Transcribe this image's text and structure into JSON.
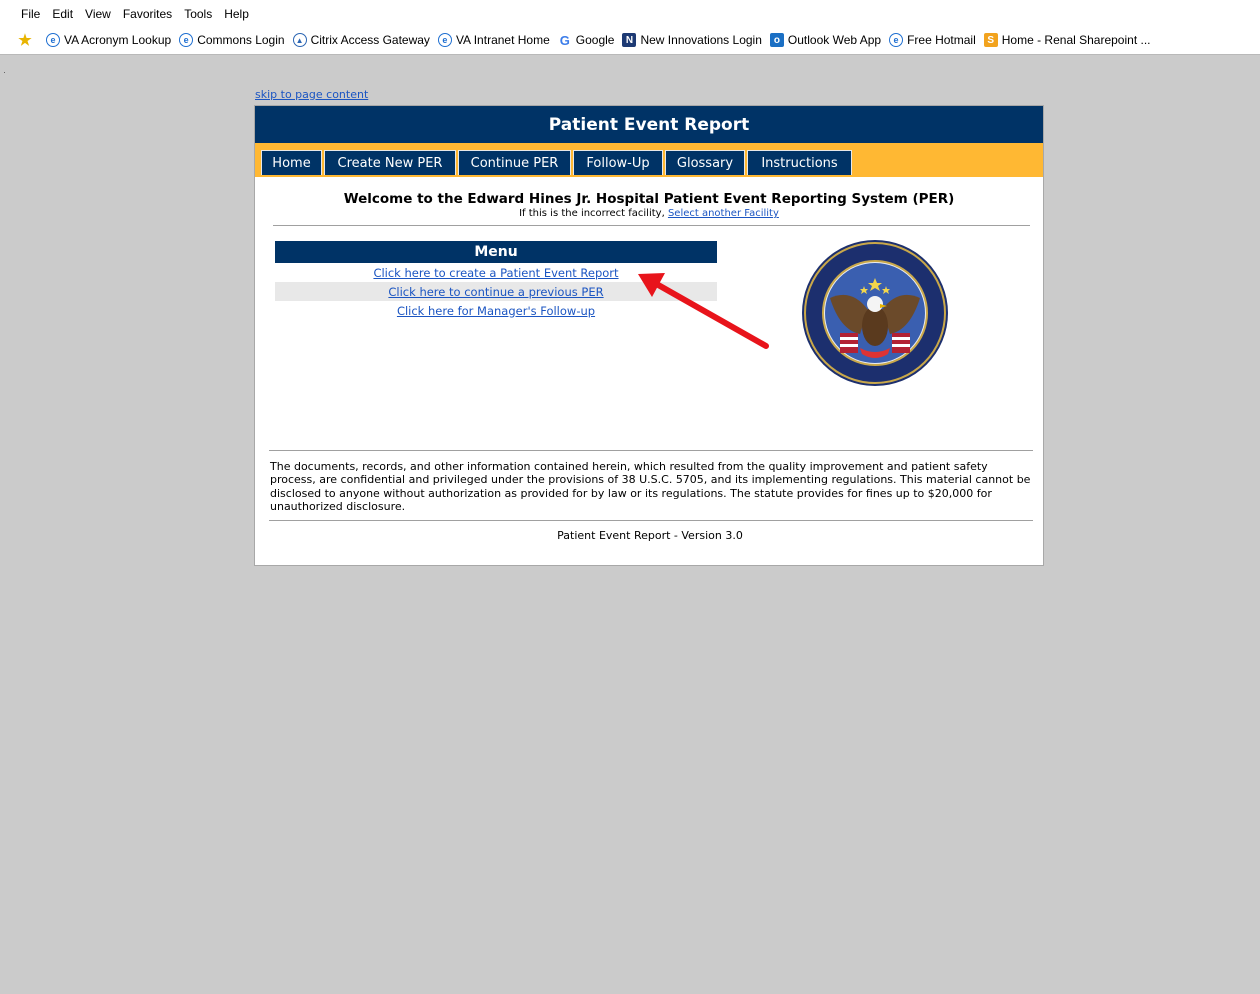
{
  "browser": {
    "menu": [
      "File",
      "Edit",
      "View",
      "Favorites",
      "Tools",
      "Help"
    ],
    "favorites": [
      {
        "label": "",
        "icon": "favorites-star-icon"
      },
      {
        "label": "VA Acronym Lookup",
        "icon": "ie-page-icon"
      },
      {
        "label": "Commons Login",
        "icon": "ie-page-icon"
      },
      {
        "label": "Citrix Access Gateway",
        "icon": "citrix-icon"
      },
      {
        "label": "VA Intranet Home",
        "icon": "ie-page-icon"
      },
      {
        "label": "Google",
        "icon": "google-icon"
      },
      {
        "label": "New Innovations Login",
        "icon": "new-innovations-icon"
      },
      {
        "label": "Outlook Web App",
        "icon": "outlook-icon"
      },
      {
        "label": "Free Hotmail",
        "icon": "ie-page-icon"
      },
      {
        "label": "Home - Renal Sharepoint ...",
        "icon": "sharepoint-icon"
      }
    ]
  },
  "page": {
    "skip_link": "skip to page content",
    "title": "Patient Event Report",
    "tabs": [
      "Home",
      "Create New PER",
      "Continue PER",
      "Follow-Up",
      "Glossary",
      "Instructions"
    ],
    "welcome": "Welcome to the Edward Hines Jr. Hospital Patient Event Reporting System (PER)",
    "facility_prefix": "If this is the incorrect facility, ",
    "facility_link": "Select another Facility",
    "menu": {
      "heading": "Menu",
      "items": [
        "Click here to create a Patient Event Report",
        "Click here to continue a previous PER",
        "Click here for Manager's Follow-up"
      ]
    },
    "seal_alt": "Department of Veterans Affairs seal",
    "disclaimer": "The documents, records, and other information contained herein, which resulted from the quality improvement and patient safety process, are confidential and privileged under the provisions of 38 U.S.C. 5705, and its implementing regulations. This material cannot be disclosed to anyone without authorization as provided for by law or its regulations. The statute provides for fines up to $20,000 for unauthorized disclosure.",
    "version": "Patient Event Report - Version 3.0"
  },
  "colors": {
    "navy": "#003366",
    "gold": "#ffb833",
    "link": "#1b55c2",
    "annotation_arrow": "#e8141b",
    "background": "#cbcbcb"
  }
}
